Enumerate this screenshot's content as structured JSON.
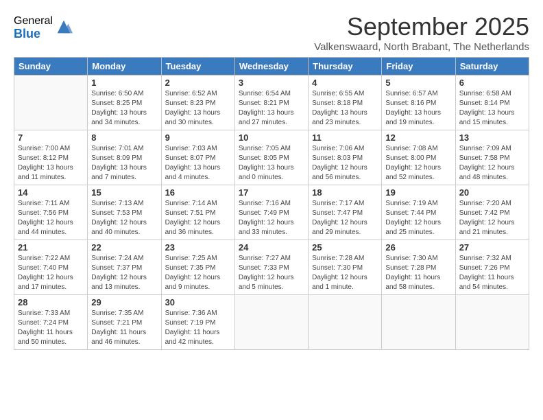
{
  "logo": {
    "general": "General",
    "blue": "Blue"
  },
  "header": {
    "month": "September 2025",
    "location": "Valkenswaard, North Brabant, The Netherlands"
  },
  "days": [
    "Sunday",
    "Monday",
    "Tuesday",
    "Wednesday",
    "Thursday",
    "Friday",
    "Saturday"
  ],
  "weeks": [
    [
      {
        "date": "",
        "sunrise": "",
        "sunset": "",
        "daylight": ""
      },
      {
        "date": "1",
        "sunrise": "Sunrise: 6:50 AM",
        "sunset": "Sunset: 8:25 PM",
        "daylight": "Daylight: 13 hours and 34 minutes."
      },
      {
        "date": "2",
        "sunrise": "Sunrise: 6:52 AM",
        "sunset": "Sunset: 8:23 PM",
        "daylight": "Daylight: 13 hours and 30 minutes."
      },
      {
        "date": "3",
        "sunrise": "Sunrise: 6:54 AM",
        "sunset": "Sunset: 8:21 PM",
        "daylight": "Daylight: 13 hours and 27 minutes."
      },
      {
        "date": "4",
        "sunrise": "Sunrise: 6:55 AM",
        "sunset": "Sunset: 8:18 PM",
        "daylight": "Daylight: 13 hours and 23 minutes."
      },
      {
        "date": "5",
        "sunrise": "Sunrise: 6:57 AM",
        "sunset": "Sunset: 8:16 PM",
        "daylight": "Daylight: 13 hours and 19 minutes."
      },
      {
        "date": "6",
        "sunrise": "Sunrise: 6:58 AM",
        "sunset": "Sunset: 8:14 PM",
        "daylight": "Daylight: 13 hours and 15 minutes."
      }
    ],
    [
      {
        "date": "7",
        "sunrise": "Sunrise: 7:00 AM",
        "sunset": "Sunset: 8:12 PM",
        "daylight": "Daylight: 13 hours and 11 minutes."
      },
      {
        "date": "8",
        "sunrise": "Sunrise: 7:01 AM",
        "sunset": "Sunset: 8:09 PM",
        "daylight": "Daylight: 13 hours and 7 minutes."
      },
      {
        "date": "9",
        "sunrise": "Sunrise: 7:03 AM",
        "sunset": "Sunset: 8:07 PM",
        "daylight": "Daylight: 13 hours and 4 minutes."
      },
      {
        "date": "10",
        "sunrise": "Sunrise: 7:05 AM",
        "sunset": "Sunset: 8:05 PM",
        "daylight": "Daylight: 13 hours and 0 minutes."
      },
      {
        "date": "11",
        "sunrise": "Sunrise: 7:06 AM",
        "sunset": "Sunset: 8:03 PM",
        "daylight": "Daylight: 12 hours and 56 minutes."
      },
      {
        "date": "12",
        "sunrise": "Sunrise: 7:08 AM",
        "sunset": "Sunset: 8:00 PM",
        "daylight": "Daylight: 12 hours and 52 minutes."
      },
      {
        "date": "13",
        "sunrise": "Sunrise: 7:09 AM",
        "sunset": "Sunset: 7:58 PM",
        "daylight": "Daylight: 12 hours and 48 minutes."
      }
    ],
    [
      {
        "date": "14",
        "sunrise": "Sunrise: 7:11 AM",
        "sunset": "Sunset: 7:56 PM",
        "daylight": "Daylight: 12 hours and 44 minutes."
      },
      {
        "date": "15",
        "sunrise": "Sunrise: 7:13 AM",
        "sunset": "Sunset: 7:53 PM",
        "daylight": "Daylight: 12 hours and 40 minutes."
      },
      {
        "date": "16",
        "sunrise": "Sunrise: 7:14 AM",
        "sunset": "Sunset: 7:51 PM",
        "daylight": "Daylight: 12 hours and 36 minutes."
      },
      {
        "date": "17",
        "sunrise": "Sunrise: 7:16 AM",
        "sunset": "Sunset: 7:49 PM",
        "daylight": "Daylight: 12 hours and 33 minutes."
      },
      {
        "date": "18",
        "sunrise": "Sunrise: 7:17 AM",
        "sunset": "Sunset: 7:47 PM",
        "daylight": "Daylight: 12 hours and 29 minutes."
      },
      {
        "date": "19",
        "sunrise": "Sunrise: 7:19 AM",
        "sunset": "Sunset: 7:44 PM",
        "daylight": "Daylight: 12 hours and 25 minutes."
      },
      {
        "date": "20",
        "sunrise": "Sunrise: 7:20 AM",
        "sunset": "Sunset: 7:42 PM",
        "daylight": "Daylight: 12 hours and 21 minutes."
      }
    ],
    [
      {
        "date": "21",
        "sunrise": "Sunrise: 7:22 AM",
        "sunset": "Sunset: 7:40 PM",
        "daylight": "Daylight: 12 hours and 17 minutes."
      },
      {
        "date": "22",
        "sunrise": "Sunrise: 7:24 AM",
        "sunset": "Sunset: 7:37 PM",
        "daylight": "Daylight: 12 hours and 13 minutes."
      },
      {
        "date": "23",
        "sunrise": "Sunrise: 7:25 AM",
        "sunset": "Sunset: 7:35 PM",
        "daylight": "Daylight: 12 hours and 9 minutes."
      },
      {
        "date": "24",
        "sunrise": "Sunrise: 7:27 AM",
        "sunset": "Sunset: 7:33 PM",
        "daylight": "Daylight: 12 hours and 5 minutes."
      },
      {
        "date": "25",
        "sunrise": "Sunrise: 7:28 AM",
        "sunset": "Sunset: 7:30 PM",
        "daylight": "Daylight: 12 hours and 1 minute."
      },
      {
        "date": "26",
        "sunrise": "Sunrise: 7:30 AM",
        "sunset": "Sunset: 7:28 PM",
        "daylight": "Daylight: 11 hours and 58 minutes."
      },
      {
        "date": "27",
        "sunrise": "Sunrise: 7:32 AM",
        "sunset": "Sunset: 7:26 PM",
        "daylight": "Daylight: 11 hours and 54 minutes."
      }
    ],
    [
      {
        "date": "28",
        "sunrise": "Sunrise: 7:33 AM",
        "sunset": "Sunset: 7:24 PM",
        "daylight": "Daylight: 11 hours and 50 minutes."
      },
      {
        "date": "29",
        "sunrise": "Sunrise: 7:35 AM",
        "sunset": "Sunset: 7:21 PM",
        "daylight": "Daylight: 11 hours and 46 minutes."
      },
      {
        "date": "30",
        "sunrise": "Sunrise: 7:36 AM",
        "sunset": "Sunset: 7:19 PM",
        "daylight": "Daylight: 11 hours and 42 minutes."
      },
      {
        "date": "",
        "sunrise": "",
        "sunset": "",
        "daylight": ""
      },
      {
        "date": "",
        "sunrise": "",
        "sunset": "",
        "daylight": ""
      },
      {
        "date": "",
        "sunrise": "",
        "sunset": "",
        "daylight": ""
      },
      {
        "date": "",
        "sunrise": "",
        "sunset": "",
        "daylight": ""
      }
    ]
  ]
}
